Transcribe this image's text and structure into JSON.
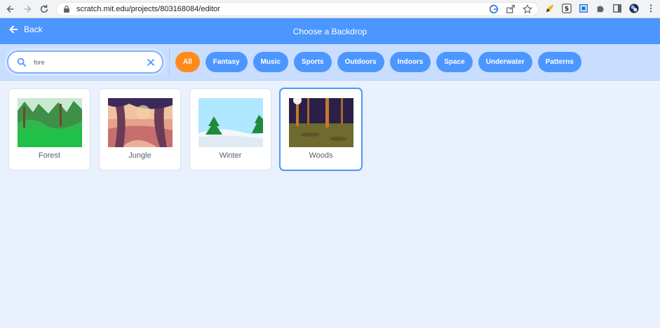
{
  "browser": {
    "url": "scratch.mit.edu/projects/803168084/editor"
  },
  "header": {
    "back_label": "Back",
    "title": "Choose a Backdrop"
  },
  "search": {
    "value": "fore"
  },
  "tags": [
    {
      "label": "All",
      "active": true
    },
    {
      "label": "Fantasy"
    },
    {
      "label": "Music"
    },
    {
      "label": "Sports"
    },
    {
      "label": "Outdoors"
    },
    {
      "label": "Indoors"
    },
    {
      "label": "Space"
    },
    {
      "label": "Underwater"
    },
    {
      "label": "Patterns"
    }
  ],
  "backdrops": [
    {
      "name": "Forest"
    },
    {
      "name": "Jungle"
    },
    {
      "name": "Winter"
    },
    {
      "name": "Woods",
      "selected": true
    }
  ],
  "colors": {
    "header": "#4c97ff",
    "tag": "#4c97ff",
    "tag_active": "#ff8c1a",
    "filter_bar": "#c9ddff",
    "page_bg": "#e9f1fc"
  }
}
